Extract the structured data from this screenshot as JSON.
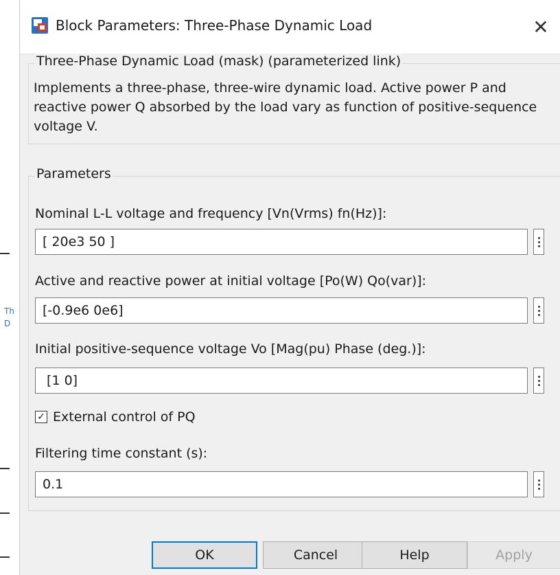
{
  "window": {
    "title": "Block Parameters: Three-Phase Dynamic Load",
    "close_glyph": "✕"
  },
  "mask": {
    "header": "Three-Phase Dynamic Load (mask) (parameterized link)",
    "description": "Implements a three-phase, three-wire dynamic load. Active  power P and reactive power Q absorbed by the load vary as function of positive-sequence voltage V."
  },
  "parameters": {
    "header": "Parameters",
    "fields": [
      {
        "label": "Nominal L-L voltage and frequency  [Vn(Vrms) fn(Hz)]:",
        "value": "[ 20e3 50 ]"
      },
      {
        "label": "Active and reactive power at initial voltage [Po(W) Qo(var)]:",
        "value": "[-0.9e6 0e6]"
      },
      {
        "label": "Initial positive-sequence voltage Vo [Mag(pu) Phase (deg.)]:",
        "value": " [1 0]"
      },
      {
        "label": "Filtering time constant (s):",
        "value": "0.1"
      }
    ],
    "external_control": {
      "label": "External control of PQ",
      "checked": true,
      "glyph": "✓"
    }
  },
  "buttons": {
    "ok": "OK",
    "cancel": "Cancel",
    "help": "Help",
    "apply": "Apply"
  },
  "background": {
    "fragment_1": "Th",
    "fragment_2": "D"
  },
  "colors": {
    "accent": "#0078d7",
    "icon_red": "#d9391f",
    "icon_blue": "#2b6fc9"
  },
  "icons": {
    "app": "simulink-block-icon",
    "close": "close-icon",
    "more": "vertical-ellipsis-icon",
    "check": "checkmark-icon"
  }
}
